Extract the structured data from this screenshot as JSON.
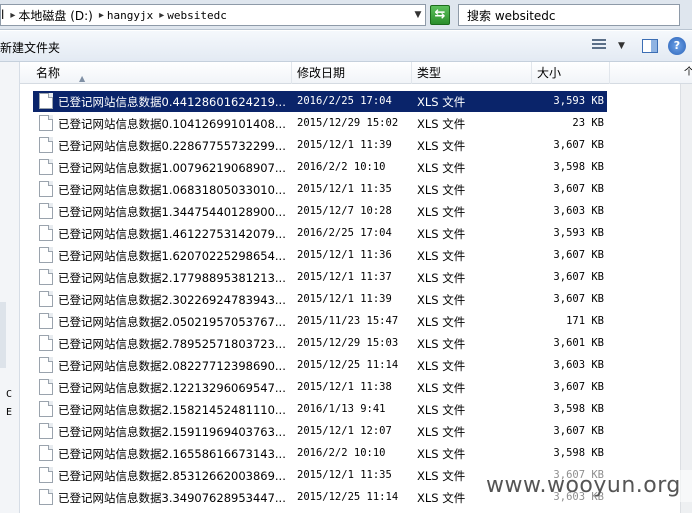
{
  "address_bar": {
    "crumbs": [
      "l",
      "本地磁盘 (D:)",
      "hangyjx",
      "websitedc"
    ]
  },
  "search": {
    "placeholder": "搜索 websitedc"
  },
  "toolbar": {
    "new_folder_label": "新建文件夹"
  },
  "nav_pane": {
    "items": [
      "C",
      "E"
    ]
  },
  "columns": {
    "name": "名称",
    "date": "修改日期",
    "type": "类型",
    "size": "大小",
    "extra": "个"
  },
  "files": [
    {
      "name": "已登记网站信息数据0.44128601624219...",
      "date": "2016/2/25 17:04",
      "type": "XLS 文件",
      "size": "3,593 KB",
      "selected": true
    },
    {
      "name": "已登记网站信息数据0.10412699101408...",
      "date": "2015/12/29 15:02",
      "type": "XLS 文件",
      "size": "23 KB"
    },
    {
      "name": "已登记网站信息数据0.22867755732299...",
      "date": "2015/12/1 11:39",
      "type": "XLS 文件",
      "size": "3,607 KB"
    },
    {
      "name": "已登记网站信息数据1.00796219068907...",
      "date": "2016/2/2 10:10",
      "type": "XLS 文件",
      "size": "3,598 KB"
    },
    {
      "name": "已登记网站信息数据1.06831805033010...",
      "date": "2015/12/1 11:35",
      "type": "XLS 文件",
      "size": "3,607 KB"
    },
    {
      "name": "已登记网站信息数据1.34475440128900...",
      "date": "2015/12/7 10:28",
      "type": "XLS 文件",
      "size": "3,603 KB"
    },
    {
      "name": "已登记网站信息数据1.46122753142079...",
      "date": "2016/2/25 17:04",
      "type": "XLS 文件",
      "size": "3,593 KB"
    },
    {
      "name": "已登记网站信息数据1.62070225298654...",
      "date": "2015/12/1 11:36",
      "type": "XLS 文件",
      "size": "3,607 KB"
    },
    {
      "name": "已登记网站信息数据2.17798895381213...",
      "date": "2015/12/1 11:37",
      "type": "XLS 文件",
      "size": "3,607 KB"
    },
    {
      "name": "已登记网站信息数据2.30226924783943...",
      "date": "2015/12/1 11:39",
      "type": "XLS 文件",
      "size": "3,607 KB"
    },
    {
      "name": "已登记网站信息数据2.05021957053767...",
      "date": "2015/11/23 15:47",
      "type": "XLS 文件",
      "size": "171 KB"
    },
    {
      "name": "已登记网站信息数据2.78952571803723...",
      "date": "2015/12/29 15:03",
      "type": "XLS 文件",
      "size": "3,601 KB"
    },
    {
      "name": "已登记网站信息数据2.08227712398690...",
      "date": "2015/12/25 11:14",
      "type": "XLS 文件",
      "size": "3,603 KB"
    },
    {
      "name": "已登记网站信息数据2.12213296069547...",
      "date": "2015/12/1 11:38",
      "type": "XLS 文件",
      "size": "3,607 KB"
    },
    {
      "name": "已登记网站信息数据2.15821452481110...",
      "date": "2016/1/13 9:41",
      "type": "XLS 文件",
      "size": "3,598 KB"
    },
    {
      "name": "已登记网站信息数据2.15911969403763...",
      "date": "2015/12/1 12:07",
      "type": "XLS 文件",
      "size": "3,607 KB"
    },
    {
      "name": "已登记网站信息数据2.16558616673143...",
      "date": "2016/2/2 10:10",
      "type": "XLS 文件",
      "size": "3,598 KB"
    },
    {
      "name": "已登记网站信息数据2.85312662003869...",
      "date": "2015/12/1 11:35",
      "type": "XLS 文件",
      "size": "3,607 KB"
    },
    {
      "name": "已登记网站信息数据3.34907628953447...",
      "date": "2015/12/25 11:14",
      "type": "XLS 文件",
      "size": "3,603 KB"
    }
  ],
  "watermark": "www.wooyun.org"
}
